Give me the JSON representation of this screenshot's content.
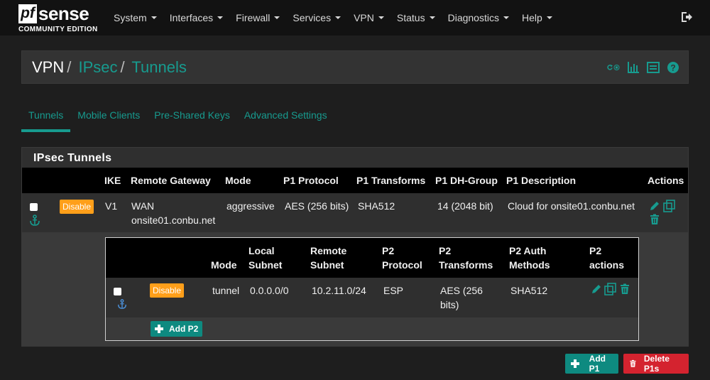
{
  "brand": {
    "logo_pf": "pf",
    "logo_sense": "sense",
    "logo_edition": "COMMUNITY EDITION"
  },
  "nav": {
    "items": [
      {
        "label": "System"
      },
      {
        "label": "Interfaces"
      },
      {
        "label": "Firewall"
      },
      {
        "label": "Services"
      },
      {
        "label": "VPN"
      },
      {
        "label": "Status"
      },
      {
        "label": "Diagnostics"
      },
      {
        "label": "Help"
      }
    ]
  },
  "breadcrumb": {
    "root": "VPN",
    "sep": "/",
    "level1": "IPsec",
    "level2": "Tunnels"
  },
  "tabs": [
    {
      "label": "Tunnels",
      "active": true
    },
    {
      "label": "Mobile Clients"
    },
    {
      "label": "Pre-Shared Keys"
    },
    {
      "label": "Advanced Settings"
    }
  ],
  "panel": {
    "title": "IPsec Tunnels",
    "columns": {
      "ike": "IKE",
      "remote_gateway": "Remote Gateway",
      "mode": "Mode",
      "p1_protocol": "P1 Protocol",
      "p1_transforms": "P1 Transforms",
      "p1_dh_group": "P1 DH-Group",
      "p1_description": "P1 Description",
      "actions": "Actions"
    },
    "p1": {
      "disable_label": "Disable",
      "ike": "V1",
      "gateway_iface": "WAN",
      "gateway_host": "onsite01.conbu.net",
      "mode": "aggressive",
      "protocol": "AES (256 bits)",
      "transforms": "SHA512",
      "dh_group": "14 (2048 bit)",
      "description": "Cloud for onsite01.conbu.net"
    },
    "p2_columns": {
      "mode": "Mode",
      "local_subnet_1": "Local",
      "local_subnet_2": "Subnet",
      "remote_subnet_1": "Remote",
      "remote_subnet_2": "Subnet",
      "protocol_1": "P2",
      "protocol_2": "Protocol",
      "transforms_1": "P2",
      "transforms_2": "Transforms",
      "auth_1": "P2 Auth",
      "auth_2": "Methods",
      "actions_1": "P2",
      "actions_2": "actions"
    },
    "p2": {
      "disable_label": "Disable",
      "mode": "tunnel",
      "local_subnet": "0.0.0.0/0",
      "remote_subnet": "10.2.11.0/24",
      "protocol": "ESP",
      "transforms_1": "AES (256",
      "transforms_2": "bits)",
      "auth": "SHA512"
    },
    "add_p2_label": "Add P2"
  },
  "footer": {
    "add_p1_label": "Add P1",
    "delete_p1_label": "Delete P1s"
  },
  "colors": {
    "accent": "#179b8f",
    "orange": "#ff9f1a",
    "danger": "#d4232f",
    "navbar": "#121212"
  }
}
